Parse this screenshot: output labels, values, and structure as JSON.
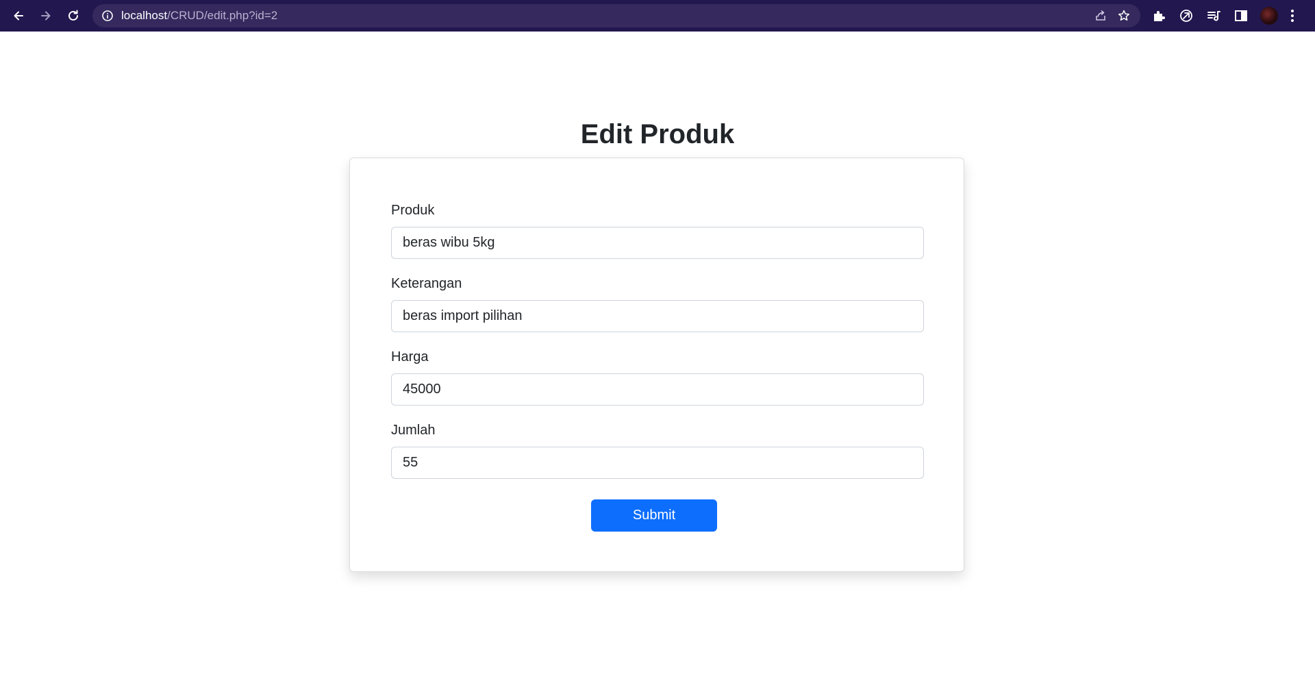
{
  "browser": {
    "url_host": "localhost",
    "url_path": "/CRUD/edit.php?id=2",
    "icons": [
      "back-arrow-icon",
      "forward-arrow-icon",
      "reload-icon",
      "info-icon",
      "share-icon",
      "star-icon",
      "extensions-icon",
      "extension-icon",
      "reading-list-icon",
      "side-panel-icon",
      "menu-icon"
    ]
  },
  "page": {
    "title": "Edit Produk"
  },
  "form": {
    "produk": {
      "label": "Produk",
      "value": "beras wibu 5kg"
    },
    "keterangan": {
      "label": "Keterangan",
      "value": "beras import pilihan"
    },
    "harga": {
      "label": "Harga",
      "value": "45000"
    },
    "jumlah": {
      "label": "Jumlah",
      "value": "55"
    },
    "submit_label": "Submit"
  },
  "colors": {
    "topbar": "#23174f",
    "omnibox": "#35295e",
    "primary": "#0d6efd"
  }
}
